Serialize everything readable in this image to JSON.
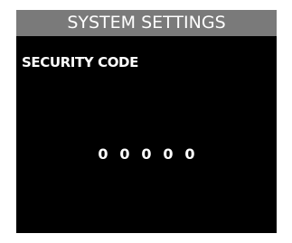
{
  "colors": {
    "screen_background": "#000000",
    "title_bar_background": "#7a7a7a",
    "text": "#ffffff"
  },
  "header": {
    "title": "SYSTEM SETTINGS"
  },
  "security": {
    "label": "SECURITY CODE",
    "digits": [
      "0",
      "0",
      "0",
      "0",
      "0"
    ]
  }
}
